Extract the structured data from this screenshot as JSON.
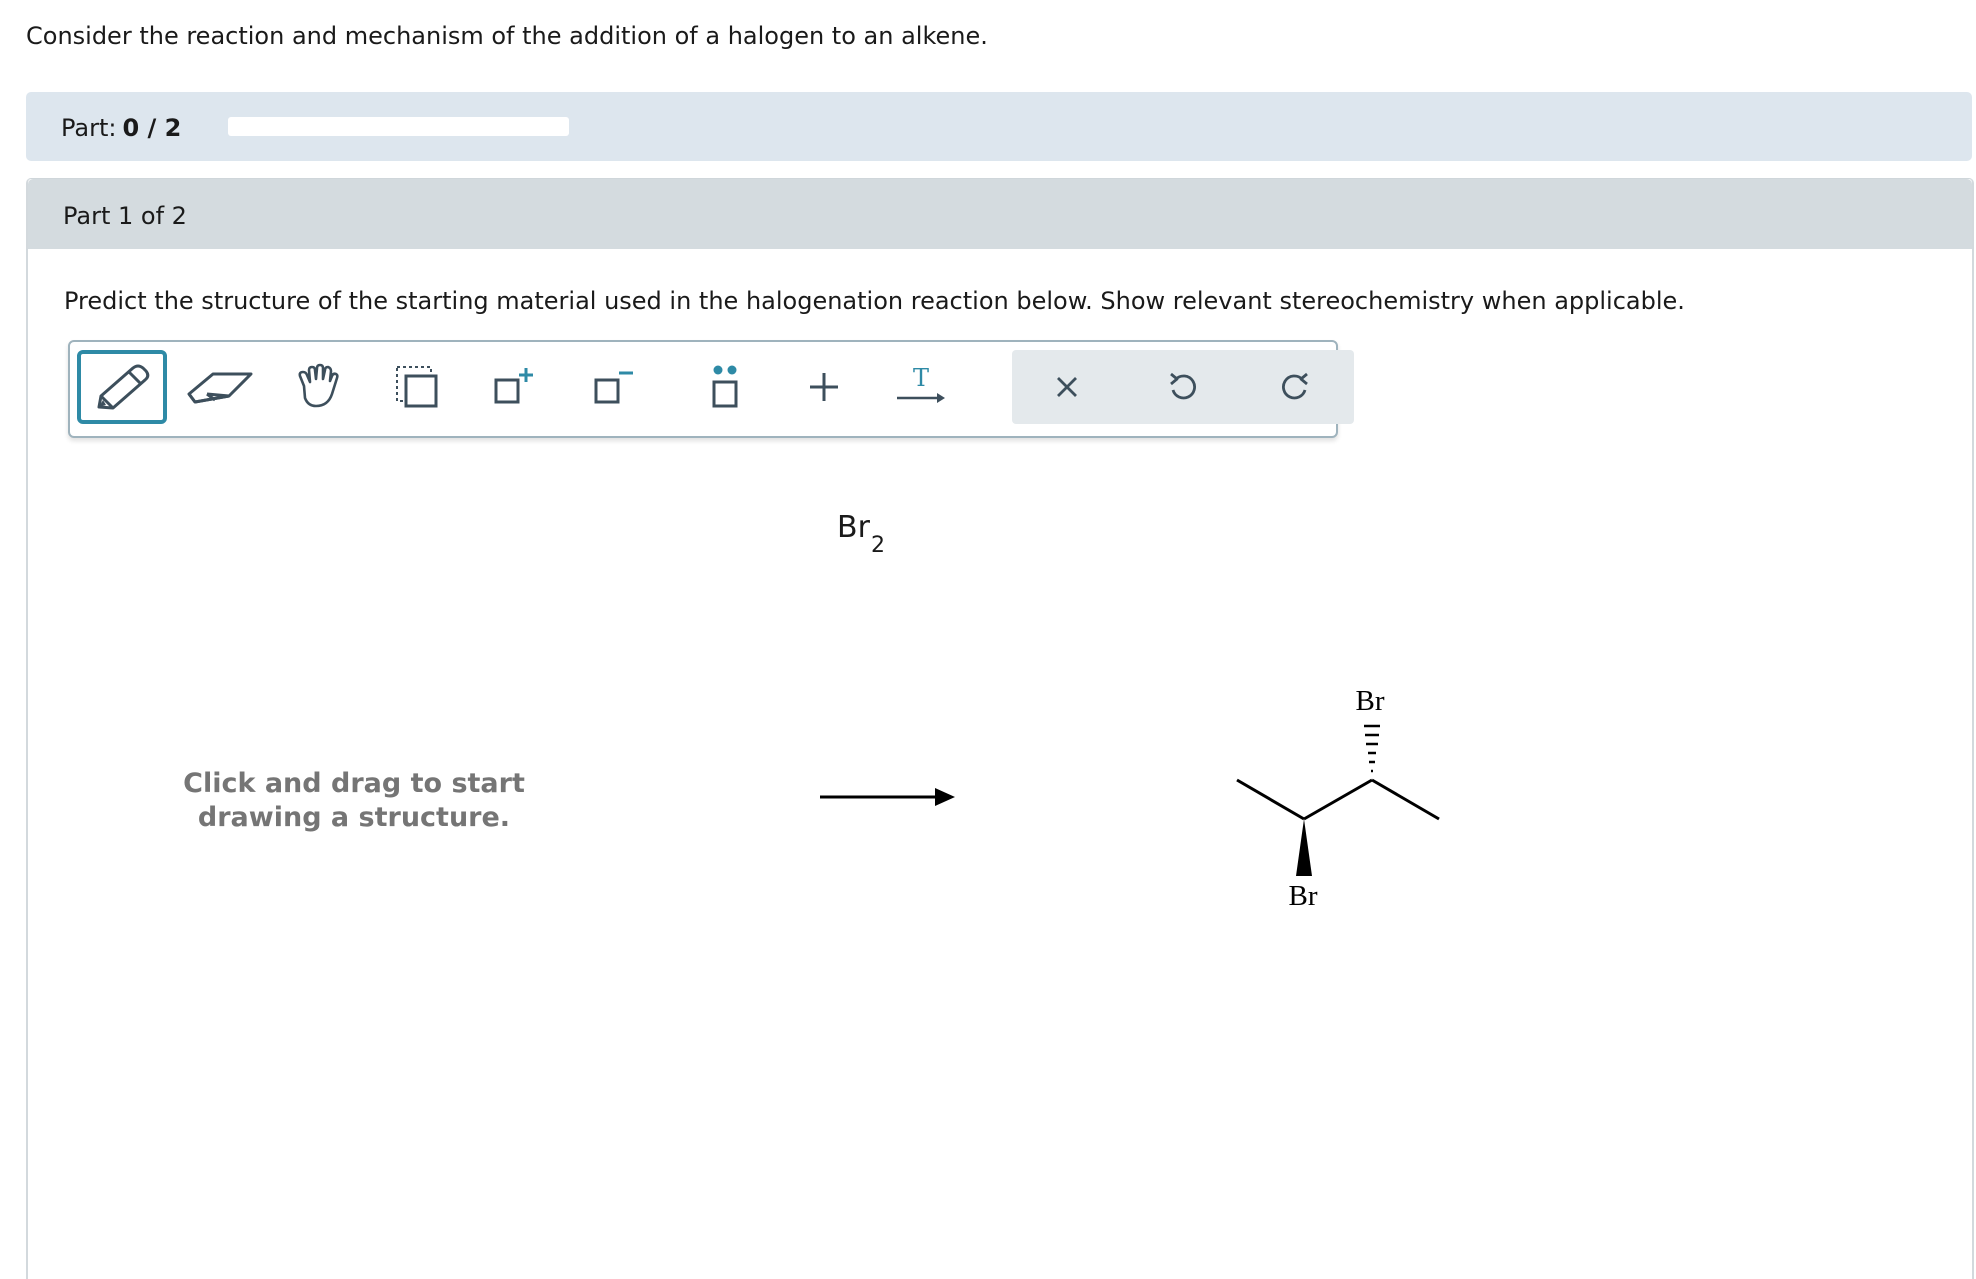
{
  "intro_text": "Consider the reaction and mechanism of the addition of a halogen to an alkene.",
  "progress": {
    "label": "Part:",
    "value_text": "0 / 2",
    "fraction": 0
  },
  "part": {
    "title": "Part 1 of 2",
    "prompt": "Predict the structure of the starting material used in the halogenation reaction below. Show relevant stereochemistry when applicable."
  },
  "toolbar": {
    "tools": [
      {
        "name": "draw-tool",
        "icon": "pencil-icon",
        "active": true
      },
      {
        "name": "erase-tool",
        "icon": "eraser-icon",
        "active": false
      },
      {
        "name": "move-tool",
        "icon": "hand-icon",
        "active": false
      },
      {
        "name": "select-tool",
        "icon": "select-box-icon",
        "active": false
      },
      {
        "name": "positive-charge-tool",
        "icon": "plus-charge-icon",
        "active": false
      },
      {
        "name": "negative-charge-tool",
        "icon": "minus-charge-icon",
        "active": false
      },
      {
        "name": "lone-pair-tool",
        "icon": "lone-pair-icon",
        "active": false
      },
      {
        "name": "add-tool",
        "icon": "plus-icon",
        "active": false
      },
      {
        "name": "reaction-text-tool",
        "icon": "text-arrow-icon",
        "active": false,
        "glyph": "T"
      }
    ],
    "actions": [
      {
        "name": "clear-button",
        "icon": "close-icon"
      },
      {
        "name": "undo-button",
        "icon": "undo-icon"
      },
      {
        "name": "redo-button",
        "icon": "redo-icon"
      }
    ]
  },
  "canvas": {
    "hint_line1": "Click and drag to start",
    "hint_line2": "drawing a structure."
  },
  "reaction": {
    "reagent": "Br",
    "reagent_subscript": "2",
    "product_top_label": "Br",
    "product_bottom_label": "Br"
  },
  "colors": {
    "accent": "#2e8aa6",
    "part_bar": "#dde6ee",
    "header": "#d4dbdf",
    "icon": "#3d4f5c"
  }
}
